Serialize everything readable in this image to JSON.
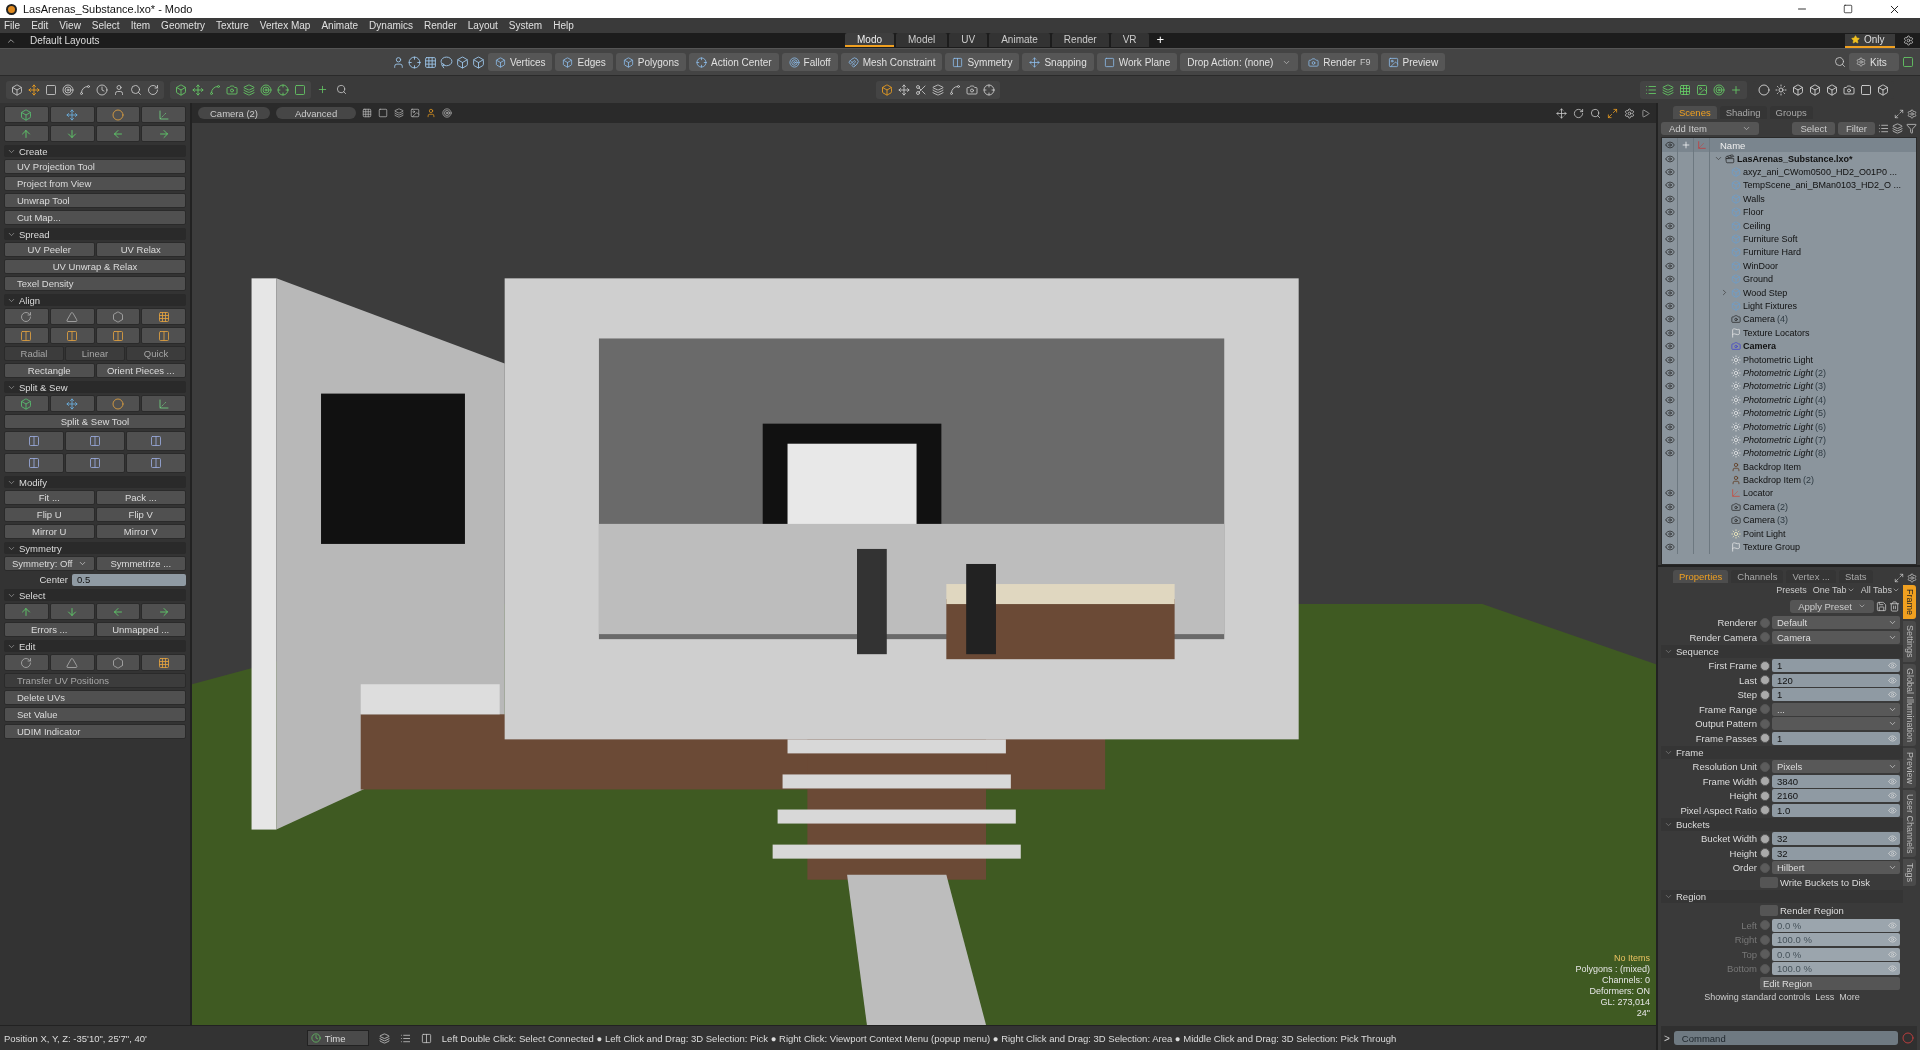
{
  "window": {
    "title": "LasArenas_Substance.lxo* - Modo"
  },
  "menu": [
    "File",
    "Edit",
    "View",
    "Select",
    "Item",
    "Geometry",
    "Texture",
    "Vertex Map",
    "Animate",
    "Dynamics",
    "Render",
    "Layout",
    "System",
    "Help"
  ],
  "layouts": {
    "label": "Default Layouts",
    "add": "+",
    "favorite": "Only",
    "tabs": [
      {
        "label": "Modo",
        "selected": true
      },
      {
        "label": "Model",
        "selected": false
      },
      {
        "label": "UV",
        "selected": false
      },
      {
        "label": "Animate",
        "selected": false
      },
      {
        "label": "Render",
        "selected": false
      },
      {
        "label": "VR",
        "selected": false
      }
    ]
  },
  "toolbar": {
    "kits": "Kits",
    "items": [
      {
        "kind": "button",
        "label": "Vertices"
      },
      {
        "kind": "button",
        "label": "Edges"
      },
      {
        "kind": "button",
        "label": "Polygons"
      },
      {
        "kind": "button",
        "label": "Action Center"
      },
      {
        "kind": "button",
        "label": "Falloff"
      },
      {
        "kind": "button",
        "label": "Mesh Constraint"
      },
      {
        "kind": "button",
        "label": "Symmetry"
      },
      {
        "kind": "button",
        "label": "Snapping"
      },
      {
        "kind": "button",
        "label": "Work Plane"
      },
      {
        "kind": "dropdown",
        "label": "Drop Action: (none)"
      },
      {
        "kind": "button",
        "label": "Render",
        "shortcut": "F9"
      },
      {
        "kind": "button",
        "label": "Preview"
      }
    ]
  },
  "left_panel": {
    "rows": [
      {
        "kind": "quad"
      },
      {
        "kind": "quad"
      }
    ],
    "sections": [
      {
        "title": "Create",
        "expanded": true,
        "rows": [
          {
            "kind": "buttons",
            "buttons": [
              {
                "label": "UV Projection Tool",
                "disabled": false
              }
            ]
          },
          {
            "kind": "buttons",
            "buttons": [
              {
                "label": "Project from View",
                "disabled": false
              }
            ]
          },
          {
            "kind": "buttons",
            "buttons": [
              {
                "label": "Unwrap Tool",
                "disabled": false
              }
            ]
          },
          {
            "kind": "buttons",
            "buttons": [
              {
                "label": "Cut Map...",
                "disabled": false
              }
            ]
          }
        ]
      },
      {
        "title": "Spread",
        "expanded": true,
        "rows": [
          {
            "kind": "buttons",
            "buttons": [
              {
                "label": "UV Peeler",
                "disabled": false
              },
              {
                "label": "UV Relax",
                "disabled": false
              }
            ]
          },
          {
            "kind": "buttons",
            "buttons": [
              {
                "label": "UV Unwrap & Relax",
                "disabled": false
              }
            ]
          },
          {
            "kind": "buttons",
            "buttons": [
              {
                "label": "Texel Density",
                "disabled": false
              }
            ]
          }
        ]
      },
      {
        "title": "Align",
        "expanded": true,
        "rows": [
          {
            "kind": "quad"
          },
          {
            "kind": "quad"
          },
          {
            "kind": "buttons",
            "buttons": [
              {
                "label": "Radial",
                "disabled": true
              },
              {
                "label": "Linear",
                "disabled": true
              },
              {
                "label": "Quick",
                "disabled": true
              }
            ]
          },
          {
            "kind": "buttons",
            "buttons": [
              {
                "label": "Rectangle",
                "disabled": false
              },
              {
                "label": "Orient Pieces ...",
                "disabled": false
              }
            ]
          }
        ]
      },
      {
        "title": "Split & Sew",
        "expanded": true,
        "rows": [
          {
            "kind": "quad"
          },
          {
            "kind": "buttons",
            "buttons": [
              {
                "label": "Split & Sew Tool",
                "disabled": false
              }
            ]
          },
          {
            "kind": "triple"
          },
          {
            "kind": "triple"
          }
        ]
      },
      {
        "title": "Modify",
        "expanded": true,
        "rows": [
          {
            "kind": "buttons",
            "buttons": [
              {
                "label": "Fit ...",
                "disabled": false
              },
              {
                "label": "Pack ...",
                "disabled": false
              }
            ]
          },
          {
            "kind": "buttons",
            "buttons": [
              {
                "label": "Flip U",
                "disabled": false
              },
              {
                "label": "Flip V",
                "disabled": false
              }
            ]
          },
          {
            "kind": "buttons",
            "buttons": [
              {
                "label": "Mirror U",
                "disabled": false
              },
              {
                "label": "Mirror V",
                "disabled": false
              }
            ]
          }
        ]
      },
      {
        "title": "Symmetry",
        "expanded": true,
        "rows": [
          {
            "kind": "buttons",
            "buttons": [
              {
                "label": "Symmetry: Off",
                "disabled": false,
                "kind": "dropdown"
              },
              {
                "label": "Symmetrize ...",
                "disabled": false,
                "kind": "plain"
              }
            ]
          },
          {
            "kind": "field",
            "label": "Center",
            "value": "0.5"
          }
        ]
      },
      {
        "title": "Select",
        "expanded": true,
        "rows": [
          {
            "kind": "quad"
          },
          {
            "kind": "buttons",
            "buttons": [
              {
                "label": "Errors ...",
                "disabled": false
              },
              {
                "label": "Unmapped ...",
                "disabled": false
              }
            ]
          }
        ]
      },
      {
        "title": "Edit",
        "expanded": true,
        "rows": [
          {
            "kind": "quad"
          },
          {
            "kind": "buttons",
            "buttons": [
              {
                "label": "Transfer UV Positions",
                "disabled": true
              }
            ]
          },
          {
            "kind": "buttons",
            "buttons": [
              {
                "label": "Delete UVs",
                "disabled": false
              }
            ]
          },
          {
            "kind": "buttons",
            "buttons": [
              {
                "label": "Set Value",
                "disabled": false
              }
            ]
          },
          {
            "kind": "buttons",
            "buttons": [
              {
                "label": "UDIM Indicator",
                "disabled": false
              }
            ]
          }
        ]
      }
    ]
  },
  "viewport": {
    "camera": "Camera (2)",
    "mode": "Advanced",
    "stats": [
      "No Items",
      "Polygons : (mixed)",
      "Channels: 0",
      "Deformers: ON",
      "GL: 273,014",
      "24\""
    ]
  },
  "scenes": {
    "add_item": "Add Item",
    "select": "Select",
    "filter": "Filter",
    "column": "Name",
    "tabs": [
      {
        "label": "Scenes",
        "selected": true
      },
      {
        "label": "Shading",
        "selected": false
      },
      {
        "label": "Groups",
        "selected": false
      }
    ],
    "root": {
      "name": "LasArenas_Substance.lxo*",
      "expanded": true,
      "visible": true,
      "children": [
        {
          "name": "axyz_ani_CWom0500_HD2_O01P0 ...",
          "kind": "mesh",
          "visible": true,
          "expandable": false,
          "instance": false,
          "active": false
        },
        {
          "name": "TempScene_ani_BMan0103_HD2_O ...",
          "kind": "mesh",
          "visible": true,
          "expandable": false,
          "instance": false,
          "active": false
        },
        {
          "name": "Walls",
          "kind": "mesh",
          "visible": true,
          "expandable": false,
          "instance": false,
          "active": false
        },
        {
          "name": "Floor",
          "kind": "mesh",
          "visible": true,
          "expandable": false,
          "instance": false,
          "active": false
        },
        {
          "name": "Ceiling",
          "kind": "mesh",
          "visible": true,
          "expandable": false,
          "instance": false,
          "active": false
        },
        {
          "name": "Furniture Soft",
          "kind": "mesh",
          "visible": true,
          "expandable": false,
          "instance": false,
          "active": false
        },
        {
          "name": "Furniture Hard",
          "kind": "mesh",
          "visible": true,
          "expandable": false,
          "instance": false,
          "active": false
        },
        {
          "name": "WinDoor",
          "kind": "mesh",
          "visible": true,
          "expandable": false,
          "instance": false,
          "active": false
        },
        {
          "name": "Ground",
          "kind": "mesh",
          "visible": true,
          "expandable": false,
          "instance": false,
          "active": false
        },
        {
          "name": "Wood Step",
          "kind": "mesh",
          "visible": true,
          "expandable": true,
          "instance": false,
          "active": false
        },
        {
          "name": "Light Fixtures",
          "kind": "mesh",
          "visible": true,
          "expandable": false,
          "instance": false,
          "active": false
        },
        {
          "name": "Camera",
          "count": "(4)",
          "kind": "camera",
          "visible": true,
          "expandable": false,
          "instance": false,
          "active": false
        },
        {
          "name": "Texture Locators",
          "kind": "group",
          "visible": true,
          "expandable": false,
          "instance": false,
          "active": false
        },
        {
          "name": "Camera",
          "kind": "render_camera",
          "visible": true,
          "expandable": false,
          "instance": false,
          "active": true
        },
        {
          "name": "Photometric Light",
          "kind": "light",
          "visible": true,
          "expandable": false,
          "instance": false,
          "active": false
        },
        {
          "name": "Photometric Light",
          "count": "(2)",
          "kind": "light",
          "visible": true,
          "expandable": false,
          "instance": true,
          "active": false
        },
        {
          "name": "Photometric Light",
          "count": "(3)",
          "kind": "light",
          "visible": true,
          "expandable": false,
          "instance": true,
          "active": false
        },
        {
          "name": "Photometric Light",
          "count": "(4)",
          "kind": "light",
          "visible": true,
          "expandable": false,
          "instance": true,
          "active": false
        },
        {
          "name": "Photometric Light",
          "count": "(5)",
          "kind": "light",
          "visible": true,
          "expandable": false,
          "instance": true,
          "active": false
        },
        {
          "name": "Photometric Light",
          "count": "(6)",
          "kind": "light",
          "visible": true,
          "expandable": false,
          "instance": true,
          "active": false
        },
        {
          "name": "Photometric Light",
          "count": "(7)",
          "kind": "light",
          "visible": true,
          "expandable": false,
          "instance": true,
          "active": false
        },
        {
          "name": "Photometric Light",
          "count": "(8)",
          "kind": "light",
          "visible": true,
          "expandable": false,
          "instance": true,
          "active": false
        },
        {
          "name": "Backdrop Item",
          "kind": "backdrop",
          "visible": false,
          "expandable": false,
          "instance": false,
          "active": false
        },
        {
          "name": "Backdrop Item",
          "count": "(2)",
          "kind": "backdrop",
          "visible": false,
          "expandable": false,
          "instance": false,
          "active": false
        },
        {
          "name": "Locator",
          "kind": "locator",
          "visible": true,
          "expandable": false,
          "instance": false,
          "active": false
        },
        {
          "name": "Camera",
          "count": "(2)",
          "kind": "camera",
          "visible": true,
          "expandable": false,
          "instance": false,
          "active": false
        },
        {
          "name": "Camera",
          "count": "(3)",
          "kind": "camera",
          "visible": true,
          "expandable": false,
          "instance": false,
          "active": false
        },
        {
          "name": "Point Light",
          "kind": "point_light",
          "visible": true,
          "expandable": false,
          "instance": false,
          "active": false
        },
        {
          "name": "Texture Group",
          "kind": "group",
          "visible": true,
          "expandable": false,
          "instance": false,
          "active": false
        }
      ]
    }
  },
  "properties": {
    "presets": "Presets",
    "one_tab": "One Tab",
    "all_tabs": "All Tabs",
    "apply_preset": "Apply Preset",
    "footer": "Showing standard controls",
    "less": "Less",
    "more": "More",
    "command_placeholder": "Command",
    "prompt": ">",
    "tabs": [
      {
        "label": "Properties",
        "selected": true
      },
      {
        "label": "Channels",
        "selected": false
      },
      {
        "label": "Vertex ...",
        "selected": false
      },
      {
        "label": "Stats",
        "selected": false
      }
    ],
    "side_tabs": [
      {
        "label": "Frame",
        "selected": true
      },
      {
        "label": "Settings",
        "selected": false
      },
      {
        "label": "Global Illumination",
        "selected": false
      },
      {
        "label": "Preview",
        "selected": false
      },
      {
        "label": "User Channels",
        "selected": false
      },
      {
        "label": "Tags",
        "selected": false
      }
    ],
    "rows": [
      {
        "kind": "dropdown",
        "label": "Renderer",
        "value": "Default",
        "disabled": false
      },
      {
        "kind": "dropdown",
        "label": "Render Camera",
        "value": "Camera",
        "disabled": false
      },
      {
        "kind": "section",
        "label": "Sequence",
        "expanded": true
      },
      {
        "kind": "number",
        "label": "First Frame",
        "value": "1",
        "disabled": false
      },
      {
        "kind": "number",
        "label": "Last",
        "value": "120",
        "disabled": false
      },
      {
        "kind": "number",
        "label": "Step",
        "value": "1",
        "disabled": false
      },
      {
        "kind": "dropdown",
        "label": "Frame Range",
        "value": "...",
        "disabled": false
      },
      {
        "kind": "dropdown",
        "label": "Output Pattern",
        "disabled": false
      },
      {
        "kind": "number",
        "label": "Frame Passes",
        "value": "1",
        "disabled": false
      },
      {
        "kind": "section",
        "label": "Frame",
        "expanded": true
      },
      {
        "kind": "dropdown",
        "label": "Resolution Unit",
        "value": "Pixels",
        "disabled": false
      },
      {
        "kind": "number",
        "label": "Frame Width",
        "value": "3840",
        "disabled": false
      },
      {
        "kind": "number",
        "label": "Height",
        "value": "2160",
        "disabled": false
      },
      {
        "kind": "number",
        "label": "Pixel Aspect Ratio",
        "value": "1.0",
        "disabled": false
      },
      {
        "kind": "section",
        "label": "Buckets",
        "expanded": true
      },
      {
        "kind": "number",
        "label": "Bucket Width",
        "value": "32",
        "disabled": false
      },
      {
        "kind": "number",
        "label": "Height",
        "value": "32",
        "disabled": false
      },
      {
        "kind": "dropdown",
        "label": "Order",
        "value": "Hilbert",
        "disabled": false
      },
      {
        "kind": "toggle",
        "label": "Write Buckets to Disk",
        "on": false,
        "disabled": false
      },
      {
        "kind": "section",
        "label": "Region",
        "expanded": true
      },
      {
        "kind": "toggle",
        "label": "Render Region",
        "on": false,
        "disabled": false
      },
      {
        "kind": "number",
        "label": "Left",
        "value": "0.0 %",
        "disabled": true
      },
      {
        "kind": "number",
        "label": "Right",
        "value": "100.0 %",
        "disabled": true
      },
      {
        "kind": "number",
        "label": "Top",
        "value": "0.0 %",
        "disabled": true
      },
      {
        "kind": "number",
        "label": "Bottom",
        "value": "100.0 %",
        "disabled": true
      },
      {
        "kind": "button",
        "label": "Edit Region",
        "disabled": false
      }
    ]
  },
  "status_bar": {
    "position": "Position X, Y, Z:  -35'10\", 25'7\", 40'",
    "time": "Time",
    "hint": "Left Double Click: Select Connected ● Left Click and Drag: 3D Selection: Pick ● Right Click: Viewport Context Menu (popup menu) ● Right Click and Drag: 3D Selection: Area ● Middle Click and Drag: 3D Selection: Pick Through"
  }
}
